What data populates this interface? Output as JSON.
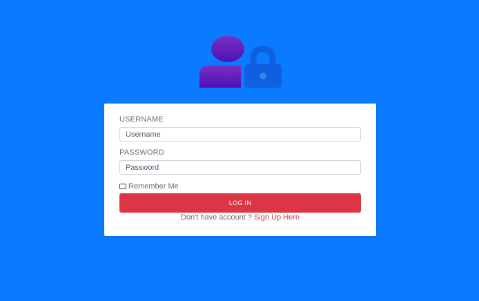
{
  "logo": {
    "icon": "user-lock-icon",
    "colors": {
      "user_gradient_top": "#7b2fbf",
      "user_gradient_bottom": "#4b12b8",
      "lock": "#0f5fe0"
    }
  },
  "form": {
    "username_label": "USERNAME",
    "username_placeholder": "Username",
    "username_value": "",
    "password_label": "PASSWORD",
    "password_placeholder": "Password",
    "password_value": "",
    "remember_label": "Remember Me",
    "remember_checked": false,
    "login_label": "LOG IN",
    "signup_prompt": "Don't have account ?",
    "signup_link": "Sign Up Here"
  },
  "colors": {
    "background": "#0a7bff",
    "card": "#ffffff",
    "button": "#dc3545",
    "link": "#dc3545"
  }
}
